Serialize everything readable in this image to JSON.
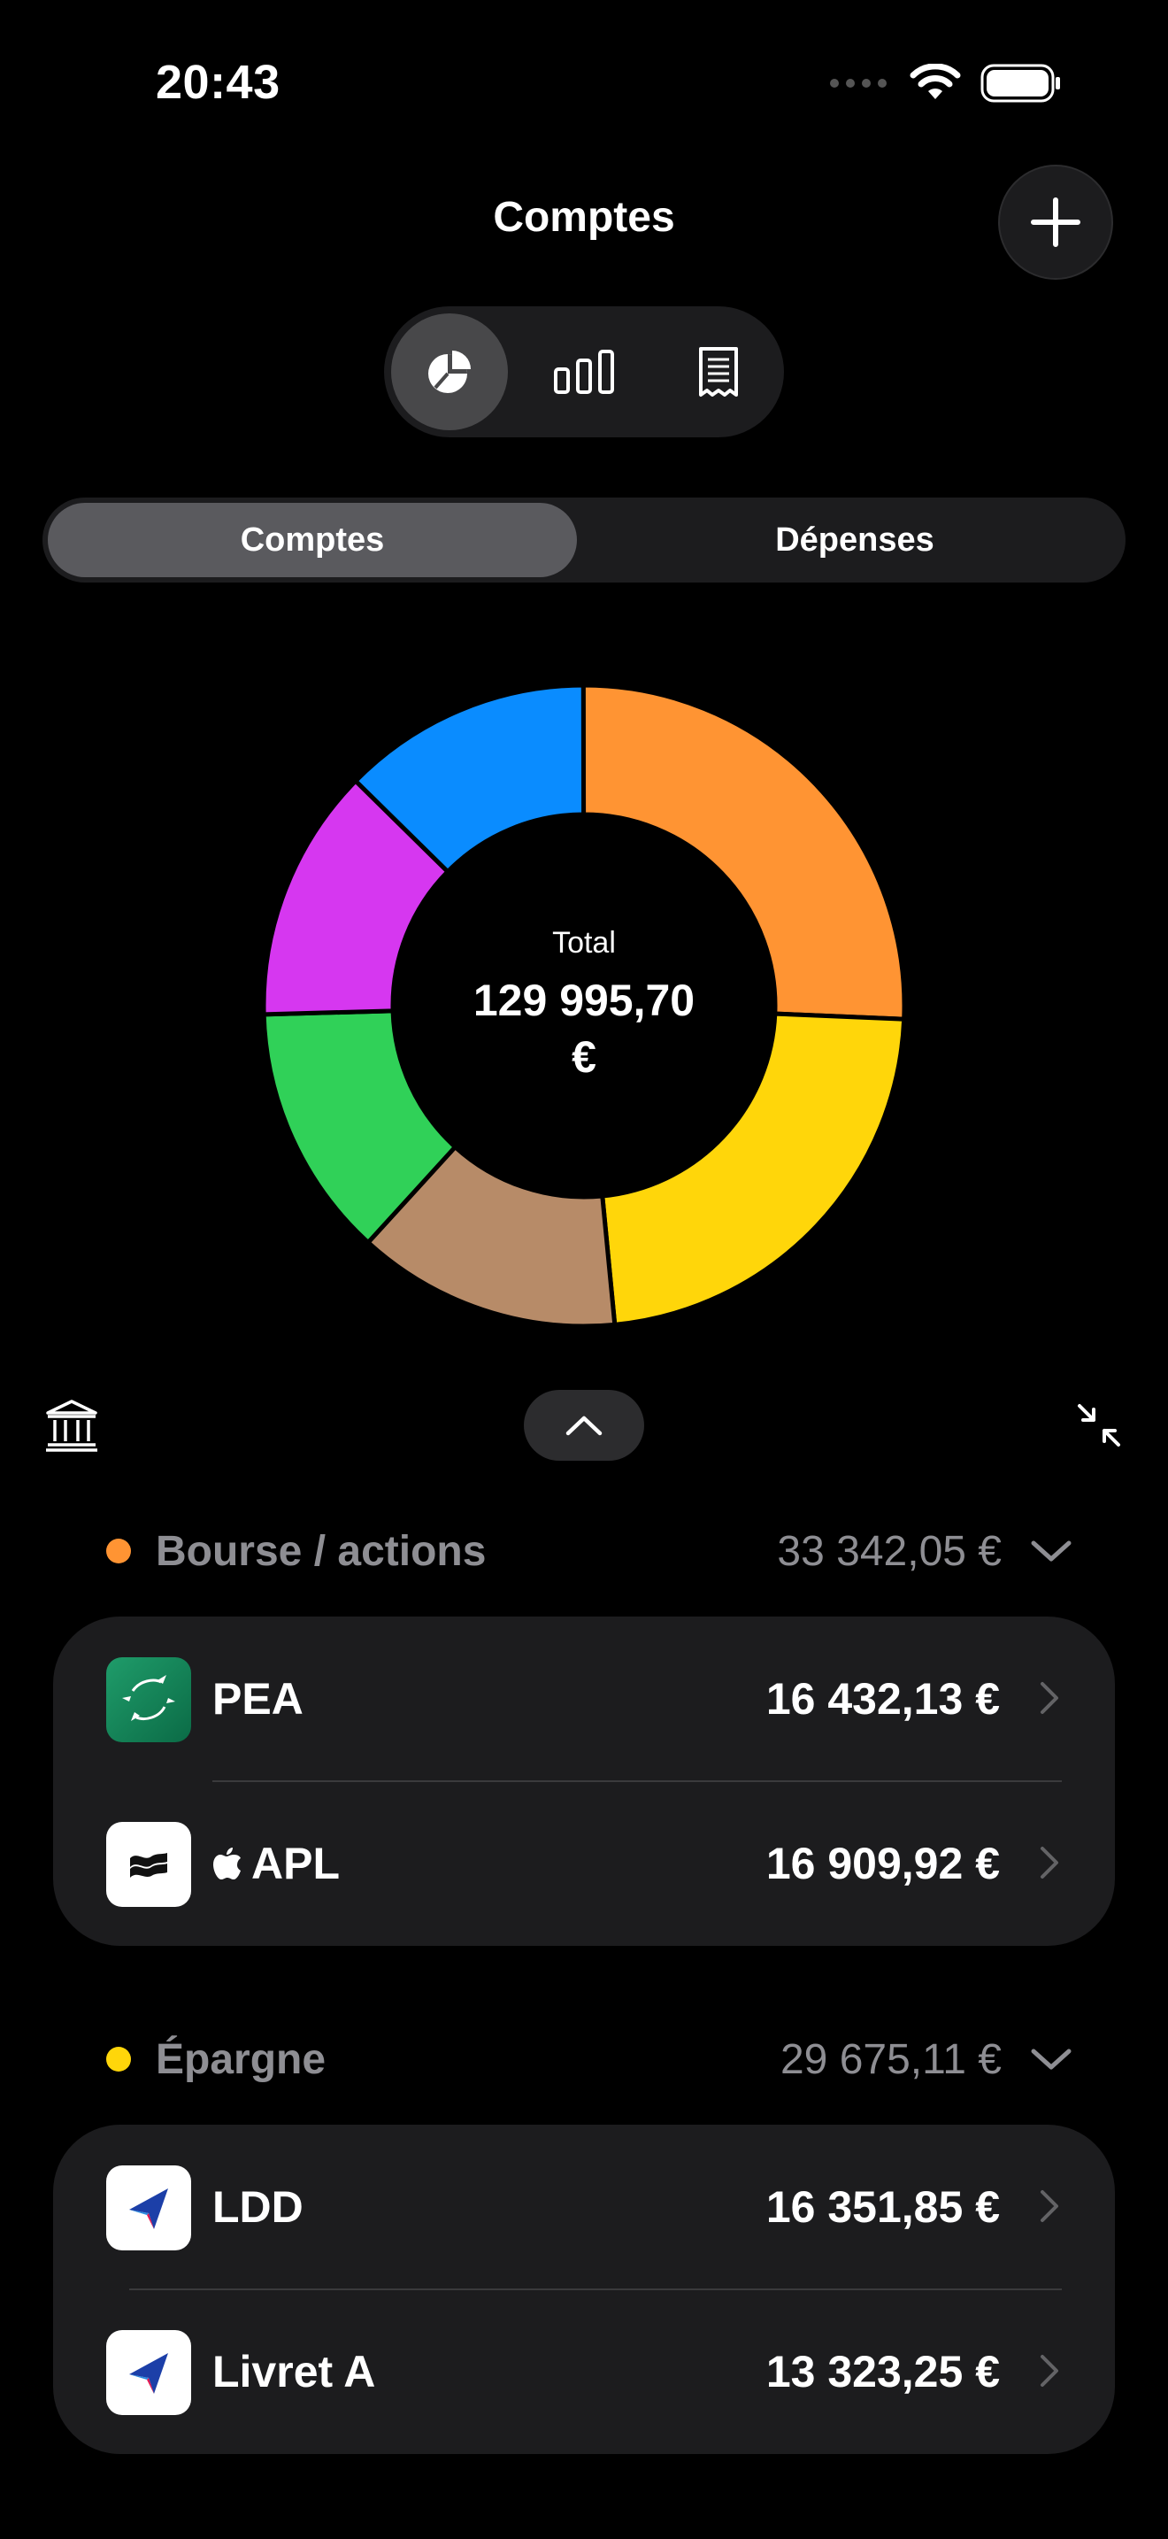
{
  "status_bar": {
    "time": "20:43"
  },
  "header": {
    "title": "Comptes"
  },
  "segment": {
    "left": "Comptes",
    "right": "Dépenses"
  },
  "colors": {
    "orange": "#ff9433",
    "yellow": "#ffd60a",
    "brown": "#b78b68",
    "green": "#30d158",
    "purple": "#d637f0",
    "blue": "#0a8cff"
  },
  "chart_data": {
    "type": "pie",
    "donut": true,
    "center_label": "Total",
    "center_value": "129 995,70 €",
    "series": [
      {
        "value": 25.7,
        "color": "#ff9433"
      },
      {
        "value": 22.8,
        "color": "#ffd60a"
      },
      {
        "value": 13.3,
        "color": "#b78b68"
      },
      {
        "value": 12.8,
        "color": "#30d158"
      },
      {
        "value": 12.8,
        "color": "#d637f0"
      },
      {
        "value": 12.6,
        "color": "#0a8cff"
      }
    ]
  },
  "groups": [
    {
      "label": "Bourse / actions",
      "total": "33 342,05 €",
      "color": "#ff9433",
      "accounts": [
        {
          "name": "PEA",
          "amount": "16 432,13 €",
          "logo": "bnp-paribas-logo"
        },
        {
          "name": "APL",
          "amount": "16 909,92 €",
          "logo": "broker-logo",
          "name_icon": "apple-icon"
        }
      ]
    },
    {
      "label": "Épargne",
      "total": "29 675,11 €",
      "color": "#ffd60a",
      "accounts": [
        {
          "name": "LDD",
          "amount": "16 351,85 €",
          "logo": "bank-arrow-logo"
        },
        {
          "name": "Livret A",
          "amount": "13 323,25 €",
          "logo": "bank-arrow-logo"
        }
      ]
    }
  ]
}
